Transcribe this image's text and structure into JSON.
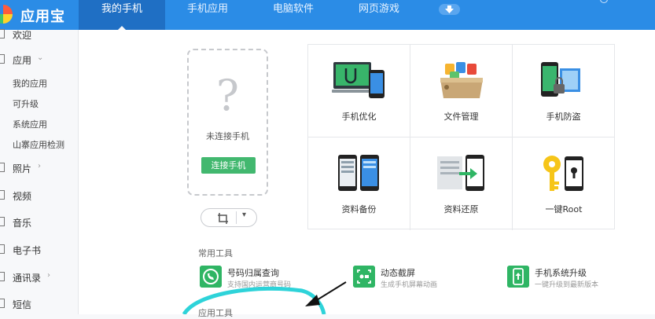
{
  "app": {
    "name": "应用宝"
  },
  "topnav": {
    "tabs": [
      {
        "label": "我的手机",
        "active": true
      },
      {
        "label": "手机应用",
        "active": false
      },
      {
        "label": "电脑软件",
        "active": false
      },
      {
        "label": "网页游戏",
        "active": false
      }
    ]
  },
  "sidebar": {
    "items": [
      {
        "label": "欢迎"
      },
      {
        "label": "应用"
      },
      {
        "label": "照片"
      },
      {
        "label": "视频"
      },
      {
        "label": "音乐"
      },
      {
        "label": "电子书"
      },
      {
        "label": "通讯录"
      },
      {
        "label": "短信"
      }
    ],
    "app_subitems": [
      "我的应用",
      "可升级",
      "系统应用",
      "山寨应用检测"
    ]
  },
  "phone": {
    "placeholder_glyph": "?",
    "status": "未连接手机",
    "connect_label": "连接手机"
  },
  "features": [
    {
      "label": "手机优化",
      "icon": "phone-optimize-icon"
    },
    {
      "label": "文件管理",
      "icon": "file-manager-icon"
    },
    {
      "label": "手机防盗",
      "icon": "anti-theft-icon"
    },
    {
      "label": "资料备份",
      "icon": "backup-icon"
    },
    {
      "label": "资料还原",
      "icon": "restore-icon"
    },
    {
      "label": "一键Root",
      "icon": "root-key-icon"
    }
  ],
  "tools": {
    "title": "常用工具",
    "items": [
      {
        "name": "号码归属查询",
        "desc": "支持国内运营商号码",
        "icon": "phone-lookup-icon"
      },
      {
        "name": "动态截屏",
        "desc": "生成手机屏幕动画",
        "icon": "screen-capture-icon"
      },
      {
        "name": "手机系统升级",
        "desc": "一键升级到最新版本",
        "icon": "system-upgrade-icon"
      }
    ],
    "second_title": "应用工具"
  },
  "colors": {
    "brand": "#2b8ce6",
    "active_tab": "#1f6fc4",
    "green": "#42b86f",
    "annotation": "#2ed3d9"
  }
}
